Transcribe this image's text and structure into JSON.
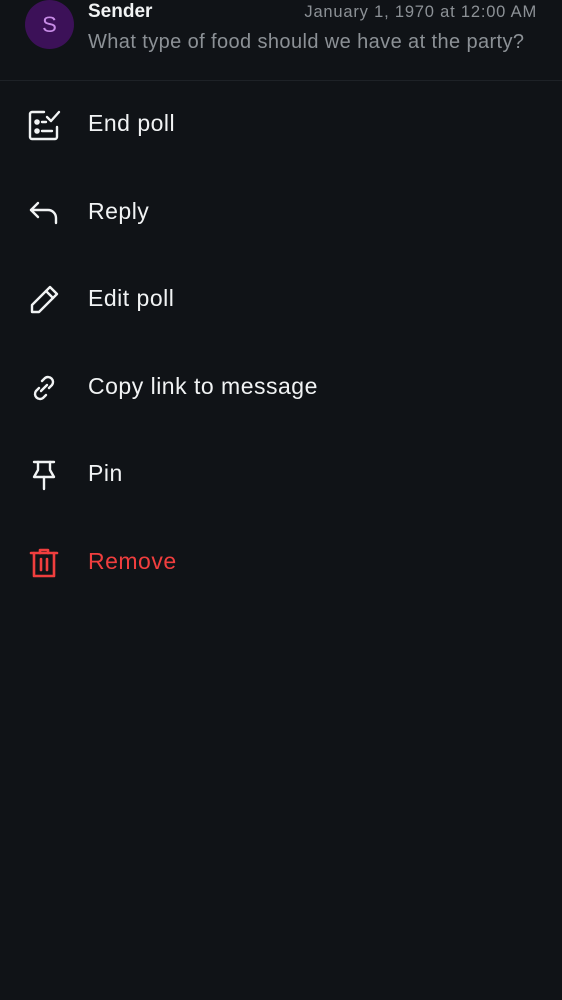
{
  "message": {
    "avatar_initial": "S",
    "sender": "Sender",
    "timestamp": "January 1, 1970 at 12:00 AM",
    "preview": "What type of food should we have at the party?"
  },
  "menu": {
    "items": [
      {
        "label": "End poll",
        "icon": "poll-end-icon"
      },
      {
        "label": "Reply",
        "icon": "reply-icon"
      },
      {
        "label": "Edit poll",
        "icon": "pencil-icon"
      },
      {
        "label": "Copy link to message",
        "icon": "link-icon"
      },
      {
        "label": "Pin",
        "icon": "pin-icon"
      },
      {
        "label": "Remove",
        "icon": "trash-icon",
        "danger": true
      }
    ]
  },
  "colors": {
    "background": "#101317",
    "text": "#f1f3f4",
    "muted": "#8c9196",
    "danger": "#f03e3e",
    "avatar_bg": "#3c1158",
    "avatar_text": "#c78be6"
  }
}
